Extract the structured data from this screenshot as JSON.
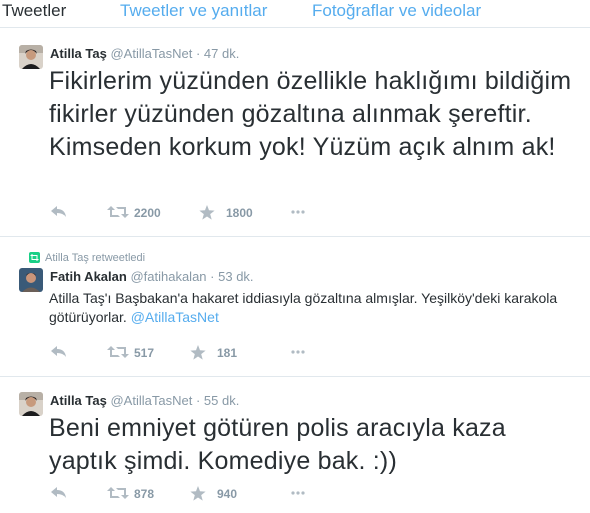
{
  "tabs": {
    "tweets": "Tweetler",
    "replies": "Tweetler ve yanıtlar",
    "media": "Fotoğraflar ve videolar"
  },
  "colors": {
    "link": "#55acee",
    "icon": "#b1bbc3",
    "retweet_badge": "#19cf86",
    "divider": "#e1e8ed"
  },
  "icons": [
    "reply-icon",
    "retweet-icon",
    "favorite-icon",
    "more-icon"
  ],
  "tweets": [
    {
      "name": "Atilla Taş",
      "handle": "@AtillaTasNet",
      "dot": "·",
      "time": "47 dk.",
      "text": "Fikirlerim yüzünden özellikle haklığımı bildiğim fikirler yüzünden gözaltına alınmak şereftir. Kimseden korkum yok! Yüzüm açık alnım ak!",
      "retweets": "2200",
      "favorites": "1800"
    },
    {
      "context": "Atilla Taş retweetledi",
      "name": "Fatih Akalan",
      "handle": "@fatihakalan",
      "dot": "·",
      "time": "53 dk.",
      "text": "Atilla Taş'ı Başbakan'a hakaret iddiasıyla gözaltına almışlar. Yeşilköy'deki karakola götürüyorlar.",
      "mention": "@AtillaTasNet",
      "retweets": "517",
      "favorites": "181"
    },
    {
      "name": "Atilla Taş",
      "handle": "@AtillaTasNet",
      "dot": "·",
      "time": "55 dk.",
      "text": "Beni emniyet götüren polis aracıyla kaza yaptık şimdi. Komediye bak. :))",
      "retweets": "878",
      "favorites": "940"
    }
  ]
}
